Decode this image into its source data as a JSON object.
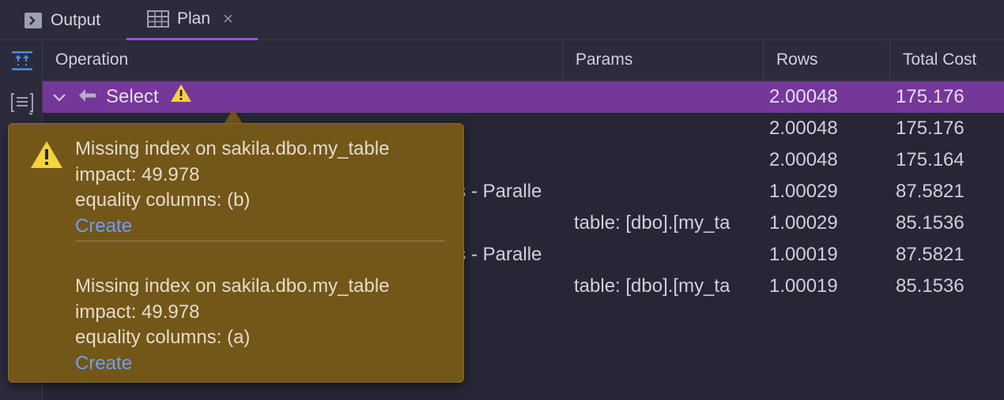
{
  "tabs": [
    {
      "label": "Output",
      "icon": "terminal-icon"
    },
    {
      "label": "Plan",
      "icon": "table-icon",
      "active": true,
      "close": "×"
    }
  ],
  "columns": [
    "Operation",
    "Params",
    "Rows",
    "Total Cost"
  ],
  "rows": [
    {
      "operation": "Select",
      "params": "",
      "rows": "2.00048",
      "total_cost": "175.176",
      "selected": true,
      "warning": true
    },
    {
      "operation": "",
      "params": "",
      "rows": "2.00048",
      "total_cost": "175.176"
    },
    {
      "operation": "",
      "params": "",
      "rows": "2.00048",
      "total_cost": "175.164"
    },
    {
      "operation": "ns - Paralle",
      "params": "",
      "rows": "1.00029",
      "total_cost": "87.5821"
    },
    {
      "operation": "",
      "params": "table: [dbo].[my_ta",
      "rows": "1.00029",
      "total_cost": "85.1536"
    },
    {
      "operation": "ns - Paralle",
      "params": "",
      "rows": "1.00019",
      "total_cost": "87.5821"
    },
    {
      "operation": "",
      "params": "table: [dbo].[my_ta",
      "rows": "1.00019",
      "total_cost": "85.1536"
    }
  ],
  "tooltip": {
    "messages": [
      {
        "title": "Missing index on sakila.dbo.my_table",
        "impact": "impact: 49.978",
        "columns": "equality columns: (b)",
        "action": "Create"
      },
      {
        "title": "Missing index on sakila.dbo.my_table",
        "impact": "impact: 49.978",
        "columns": "equality columns: (a)",
        "action": "Create"
      }
    ]
  },
  "colors": {
    "background": "#262636",
    "selected_row": "#76379a",
    "tooltip_bg": "#735719",
    "link": "#6f9df4",
    "warning": "#f5d33a",
    "tab_underline": "#9d4edd"
  }
}
